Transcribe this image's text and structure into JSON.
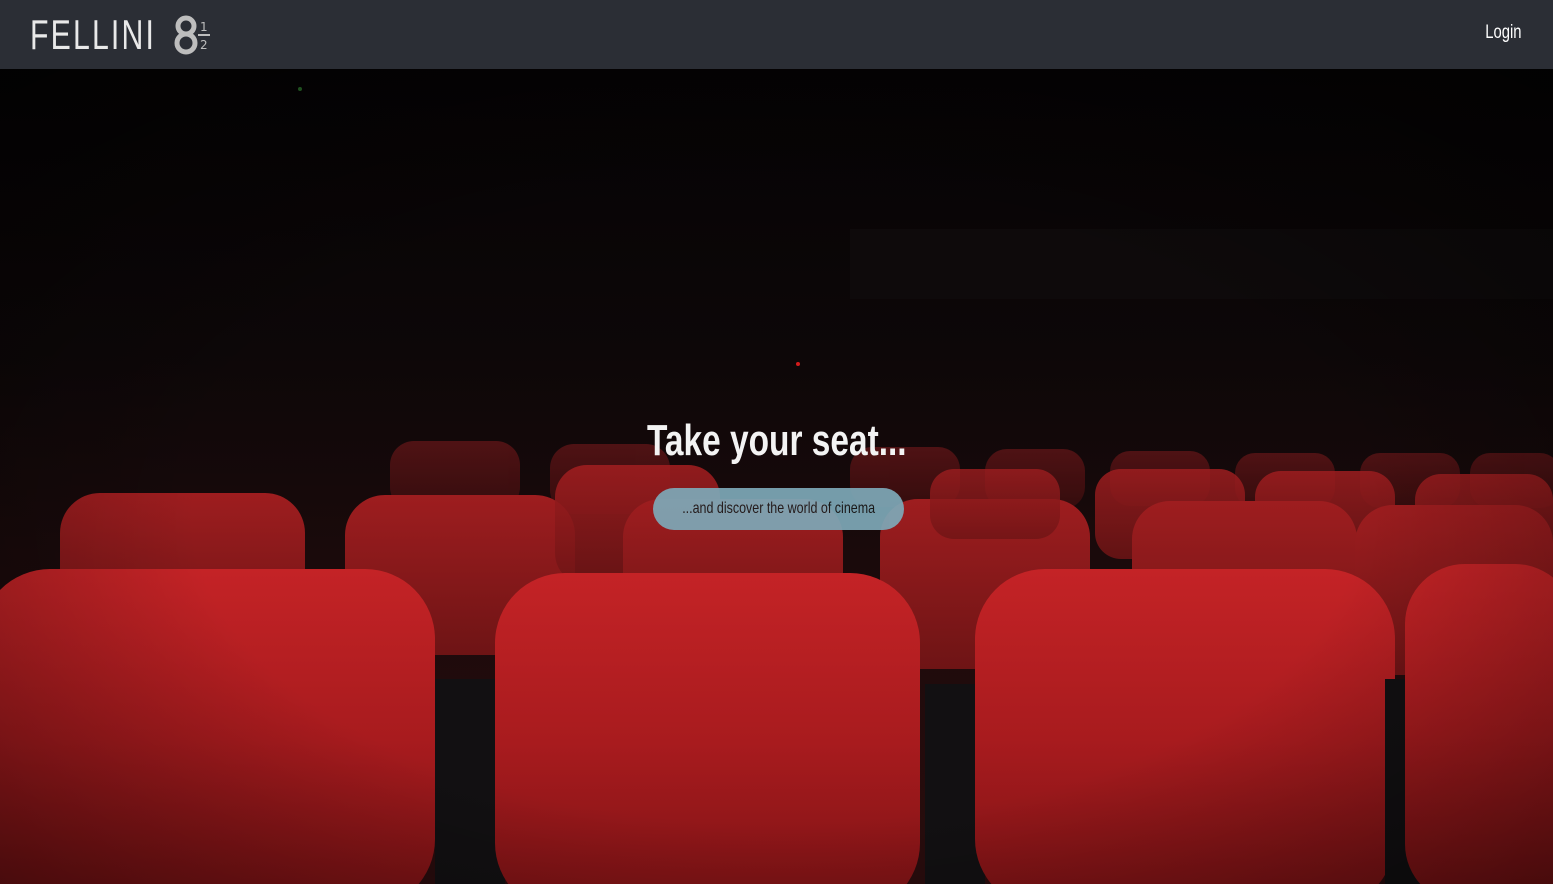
{
  "navbar": {
    "brand_name": "FELLINI",
    "logo_icon": "eight-and-a-half-logo",
    "login_label": "Login",
    "background_color": "#2b2e35"
  },
  "hero": {
    "title": "Take your seat...",
    "cta_label": "...and discover the world of cinema",
    "cta_color": "#7ea9b8",
    "background_image": "cinema-red-seats"
  }
}
